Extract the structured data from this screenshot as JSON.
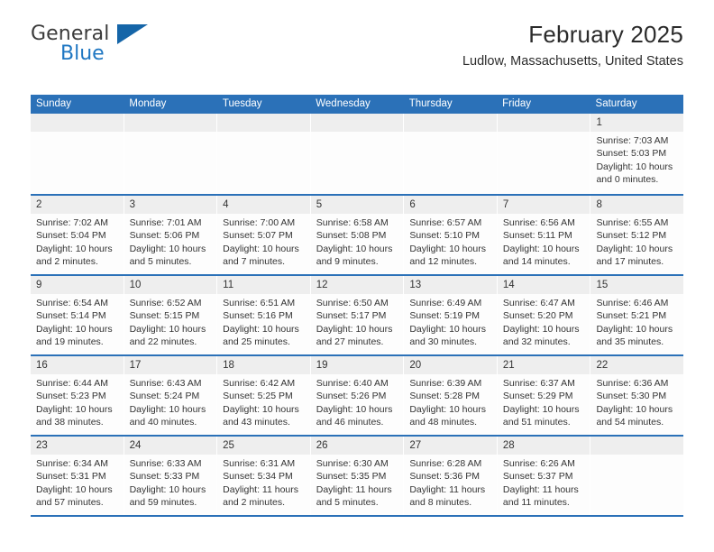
{
  "brand": {
    "name_part1": "General",
    "name_part2": "Blue",
    "logo_icon": "triangle-logo-icon"
  },
  "header": {
    "title": "February 2025",
    "subtitle": "Ludlow, Massachusetts, United States"
  },
  "colors": {
    "accent_blue": "#2b71b8",
    "logo_blue": "#1f77c2",
    "day_band": "#eeeeee",
    "text": "#333333"
  },
  "weekdays": [
    "Sunday",
    "Monday",
    "Tuesday",
    "Wednesday",
    "Thursday",
    "Friday",
    "Saturday"
  ],
  "weeks": [
    [
      {
        "day": "",
        "empty": true
      },
      {
        "day": "",
        "empty": true
      },
      {
        "day": "",
        "empty": true
      },
      {
        "day": "",
        "empty": true
      },
      {
        "day": "",
        "empty": true
      },
      {
        "day": "",
        "empty": true
      },
      {
        "day": "1",
        "sunrise": "Sunrise: 7:03 AM",
        "sunset": "Sunset: 5:03 PM",
        "daylight": "Daylight: 10 hours and 0 minutes."
      }
    ],
    [
      {
        "day": "2",
        "sunrise": "Sunrise: 7:02 AM",
        "sunset": "Sunset: 5:04 PM",
        "daylight": "Daylight: 10 hours and 2 minutes."
      },
      {
        "day": "3",
        "sunrise": "Sunrise: 7:01 AM",
        "sunset": "Sunset: 5:06 PM",
        "daylight": "Daylight: 10 hours and 5 minutes."
      },
      {
        "day": "4",
        "sunrise": "Sunrise: 7:00 AM",
        "sunset": "Sunset: 5:07 PM",
        "daylight": "Daylight: 10 hours and 7 minutes."
      },
      {
        "day": "5",
        "sunrise": "Sunrise: 6:58 AM",
        "sunset": "Sunset: 5:08 PM",
        "daylight": "Daylight: 10 hours and 9 minutes."
      },
      {
        "day": "6",
        "sunrise": "Sunrise: 6:57 AM",
        "sunset": "Sunset: 5:10 PM",
        "daylight": "Daylight: 10 hours and 12 minutes."
      },
      {
        "day": "7",
        "sunrise": "Sunrise: 6:56 AM",
        "sunset": "Sunset: 5:11 PM",
        "daylight": "Daylight: 10 hours and 14 minutes."
      },
      {
        "day": "8",
        "sunrise": "Sunrise: 6:55 AM",
        "sunset": "Sunset: 5:12 PM",
        "daylight": "Daylight: 10 hours and 17 minutes."
      }
    ],
    [
      {
        "day": "9",
        "sunrise": "Sunrise: 6:54 AM",
        "sunset": "Sunset: 5:14 PM",
        "daylight": "Daylight: 10 hours and 19 minutes."
      },
      {
        "day": "10",
        "sunrise": "Sunrise: 6:52 AM",
        "sunset": "Sunset: 5:15 PM",
        "daylight": "Daylight: 10 hours and 22 minutes."
      },
      {
        "day": "11",
        "sunrise": "Sunrise: 6:51 AM",
        "sunset": "Sunset: 5:16 PM",
        "daylight": "Daylight: 10 hours and 25 minutes."
      },
      {
        "day": "12",
        "sunrise": "Sunrise: 6:50 AM",
        "sunset": "Sunset: 5:17 PM",
        "daylight": "Daylight: 10 hours and 27 minutes."
      },
      {
        "day": "13",
        "sunrise": "Sunrise: 6:49 AM",
        "sunset": "Sunset: 5:19 PM",
        "daylight": "Daylight: 10 hours and 30 minutes."
      },
      {
        "day": "14",
        "sunrise": "Sunrise: 6:47 AM",
        "sunset": "Sunset: 5:20 PM",
        "daylight": "Daylight: 10 hours and 32 minutes."
      },
      {
        "day": "15",
        "sunrise": "Sunrise: 6:46 AM",
        "sunset": "Sunset: 5:21 PM",
        "daylight": "Daylight: 10 hours and 35 minutes."
      }
    ],
    [
      {
        "day": "16",
        "sunrise": "Sunrise: 6:44 AM",
        "sunset": "Sunset: 5:23 PM",
        "daylight": "Daylight: 10 hours and 38 minutes."
      },
      {
        "day": "17",
        "sunrise": "Sunrise: 6:43 AM",
        "sunset": "Sunset: 5:24 PM",
        "daylight": "Daylight: 10 hours and 40 minutes."
      },
      {
        "day": "18",
        "sunrise": "Sunrise: 6:42 AM",
        "sunset": "Sunset: 5:25 PM",
        "daylight": "Daylight: 10 hours and 43 minutes."
      },
      {
        "day": "19",
        "sunrise": "Sunrise: 6:40 AM",
        "sunset": "Sunset: 5:26 PM",
        "daylight": "Daylight: 10 hours and 46 minutes."
      },
      {
        "day": "20",
        "sunrise": "Sunrise: 6:39 AM",
        "sunset": "Sunset: 5:28 PM",
        "daylight": "Daylight: 10 hours and 48 minutes."
      },
      {
        "day": "21",
        "sunrise": "Sunrise: 6:37 AM",
        "sunset": "Sunset: 5:29 PM",
        "daylight": "Daylight: 10 hours and 51 minutes."
      },
      {
        "day": "22",
        "sunrise": "Sunrise: 6:36 AM",
        "sunset": "Sunset: 5:30 PM",
        "daylight": "Daylight: 10 hours and 54 minutes."
      }
    ],
    [
      {
        "day": "23",
        "sunrise": "Sunrise: 6:34 AM",
        "sunset": "Sunset: 5:31 PM",
        "daylight": "Daylight: 10 hours and 57 minutes."
      },
      {
        "day": "24",
        "sunrise": "Sunrise: 6:33 AM",
        "sunset": "Sunset: 5:33 PM",
        "daylight": "Daylight: 10 hours and 59 minutes."
      },
      {
        "day": "25",
        "sunrise": "Sunrise: 6:31 AM",
        "sunset": "Sunset: 5:34 PM",
        "daylight": "Daylight: 11 hours and 2 minutes."
      },
      {
        "day": "26",
        "sunrise": "Sunrise: 6:30 AM",
        "sunset": "Sunset: 5:35 PM",
        "daylight": "Daylight: 11 hours and 5 minutes."
      },
      {
        "day": "27",
        "sunrise": "Sunrise: 6:28 AM",
        "sunset": "Sunset: 5:36 PM",
        "daylight": "Daylight: 11 hours and 8 minutes."
      },
      {
        "day": "28",
        "sunrise": "Sunrise: 6:26 AM",
        "sunset": "Sunset: 5:37 PM",
        "daylight": "Daylight: 11 hours and 11 minutes."
      },
      {
        "day": "",
        "empty": true
      }
    ]
  ]
}
